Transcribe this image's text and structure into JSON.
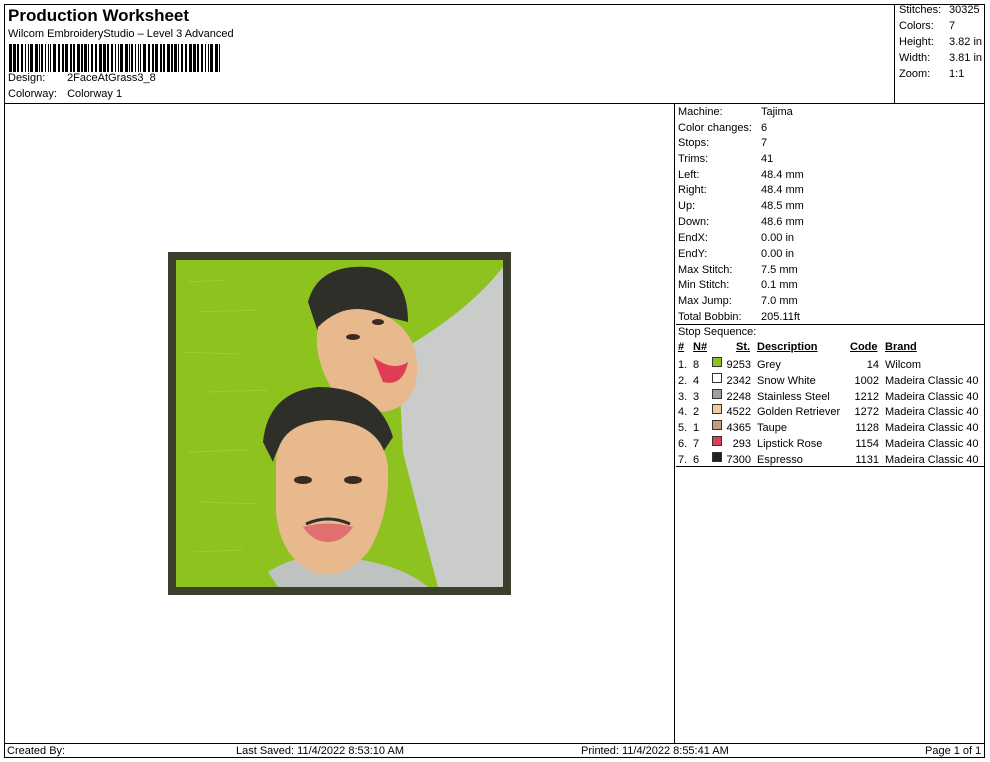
{
  "header": {
    "title": "Production Worksheet",
    "subtitle": "Wilcom EmbroideryStudio – Level 3 Advanced",
    "design_label": "Design:",
    "design_value": "2FaceAtGrass3_8",
    "colorway_label": "Colorway:",
    "colorway_value": "Colorway 1"
  },
  "summary": [
    {
      "k": "Stitches:",
      "v": "30325"
    },
    {
      "k": "Colors:",
      "v": "7"
    },
    {
      "k": "Height:",
      "v": "3.82 in"
    },
    {
      "k": "Width:",
      "v": "3.81 in"
    },
    {
      "k": "Zoom:",
      "v": "1:1"
    }
  ],
  "machine_info": [
    {
      "k": "Machine:",
      "v": "Tajima"
    },
    {
      "k": "Color changes:",
      "v": "6"
    },
    {
      "k": "Stops:",
      "v": "7"
    },
    {
      "k": "Trims:",
      "v": "41"
    },
    {
      "k": "Left:",
      "v": "48.4 mm"
    },
    {
      "k": "Right:",
      "v": "48.4 mm"
    },
    {
      "k": "Up:",
      "v": "48.5 mm"
    },
    {
      "k": "Down:",
      "v": "48.6 mm"
    },
    {
      "k": "EndX:",
      "v": "0.00 in"
    },
    {
      "k": "EndY:",
      "v": "0.00 in"
    },
    {
      "k": "Max Stitch:",
      "v": "7.5 mm"
    },
    {
      "k": "Min Stitch:",
      "v": "0.1 mm"
    },
    {
      "k": "Max Jump:",
      "v": "7.0 mm"
    },
    {
      "k": "Total Bobbin:",
      "v": "205.11ft"
    }
  ],
  "stop_sequence": {
    "title": "Stop Sequence:",
    "headers": {
      "num": "#",
      "n": "N#",
      "st": "St.",
      "desc": "Description",
      "code": "Code",
      "brand": "Brand"
    },
    "rows": [
      {
        "num": "1.",
        "n": "8",
        "st": "9253",
        "desc": "Grey",
        "code": "14",
        "brand": "Wilcom",
        "color": "#8dc21f"
      },
      {
        "num": "2.",
        "n": "4",
        "st": "2342",
        "desc": "Snow White",
        "code": "1002",
        "brand": "Madeira Classic 40",
        "color": "#ffffff"
      },
      {
        "num": "3.",
        "n": "3",
        "st": "2248",
        "desc": "Stainless Steel",
        "code": "1212",
        "brand": "Madeira Classic 40",
        "color": "#9aa0a3"
      },
      {
        "num": "4.",
        "n": "2",
        "st": "4522",
        "desc": "Golden Retriever",
        "code": "1272",
        "brand": "Madeira Classic 40",
        "color": "#f3c89a"
      },
      {
        "num": "5.",
        "n": "1",
        "st": "4365",
        "desc": "Taupe",
        "code": "1128",
        "brand": "Madeira Classic 40",
        "color": "#c99a7e"
      },
      {
        "num": "6.",
        "n": "7",
        "st": "293",
        "desc": "Lipstick Rose",
        "code": "1154",
        "brand": "Madeira Classic 40",
        "color": "#e03c55"
      },
      {
        "num": "7.",
        "n": "6",
        "st": "7300",
        "desc": "Espresso",
        "code": "1131",
        "brand": "Madeira Classic 40",
        "color": "#222222"
      }
    ]
  },
  "footer": {
    "created_by": "Created By:",
    "last_saved": "Last Saved: 11/4/2022 8:53:10 AM",
    "printed": "Printed: 11/4/2022 8:55:41 AM",
    "page": "Page 1 of 1"
  }
}
